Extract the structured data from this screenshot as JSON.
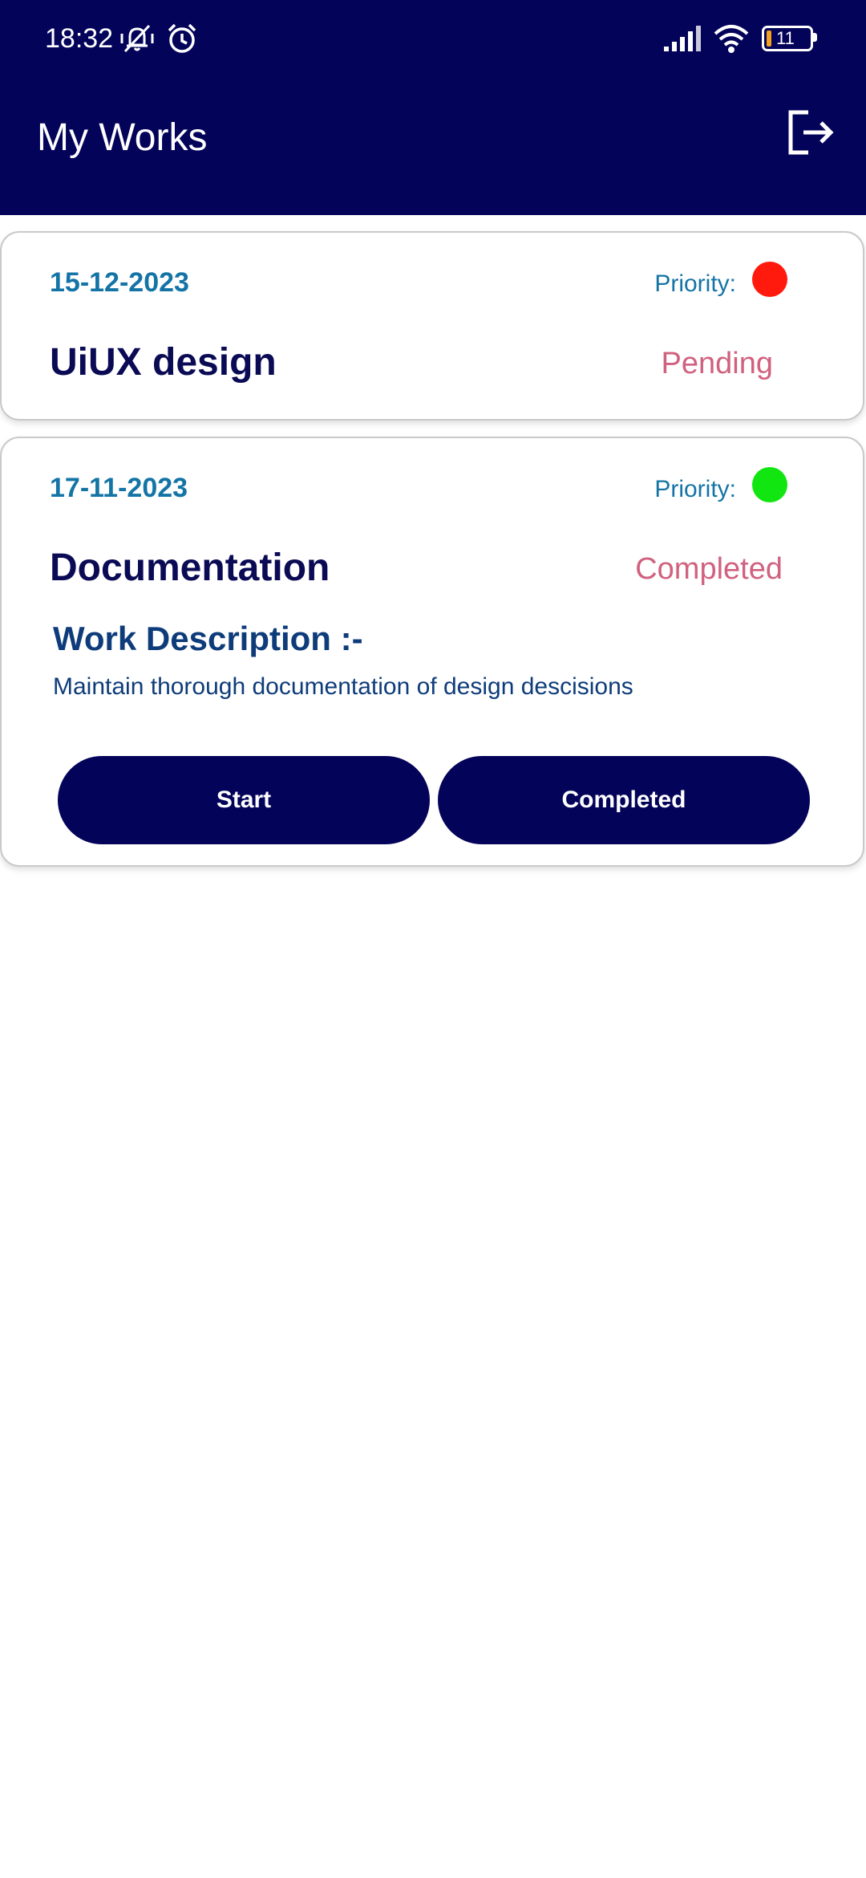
{
  "status_bar": {
    "time": "18:32",
    "battery_level": "11",
    "icons": [
      "vibrate-mute-icon",
      "alarm-icon",
      "signal-icon",
      "wifi-icon",
      "battery-icon"
    ]
  },
  "app_bar": {
    "title": "My Works",
    "logout_icon": "logout-icon"
  },
  "works": [
    {
      "date": "15-12-2023",
      "priority_label": "Priority:",
      "priority_color": "#ff1a0d",
      "title": "UiUX design",
      "status": "Pending"
    },
    {
      "date": "17-11-2023",
      "priority_label": "Priority:",
      "priority_color": "#11e611",
      "title": "Documentation",
      "status": "Completed",
      "description_heading": "Work Description :-",
      "description": "Maintain thorough documentation of design descisions",
      "actions": {
        "start_label": "Start",
        "completed_label": "Completed"
      }
    }
  ],
  "colors": {
    "header_bg": "#03035a",
    "date_blue": "#1474a6",
    "title_navy": "#0a0a55",
    "status_pink": "#d0617f",
    "button_bg": "#03035a"
  }
}
